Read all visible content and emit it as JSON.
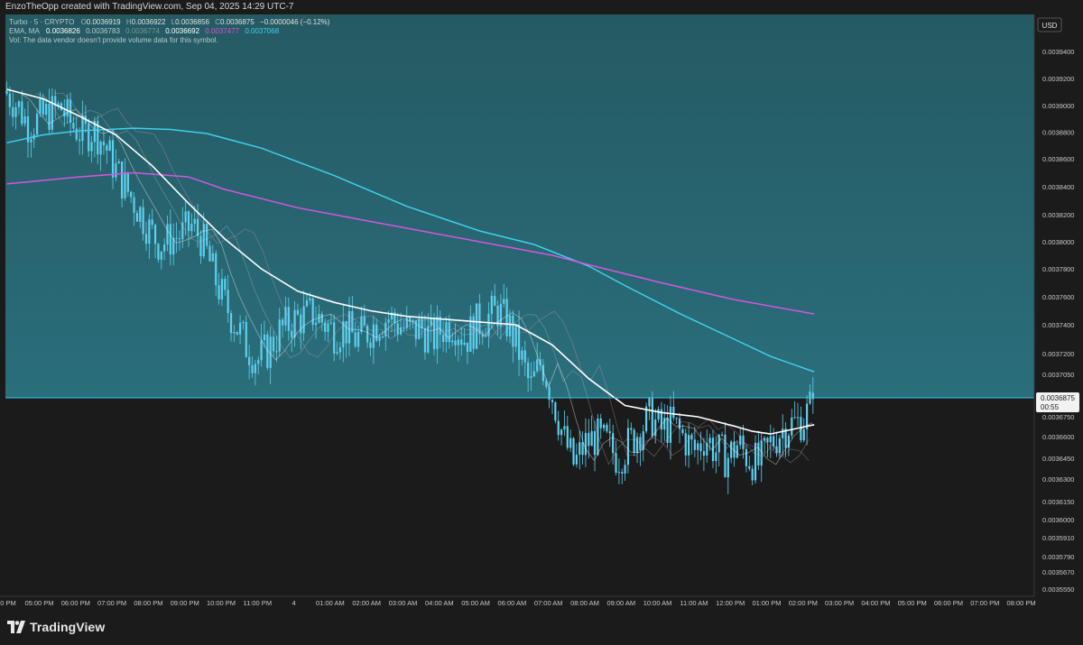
{
  "header": {
    "title": "EnzoTheOpp created with TradingView.com, Sep 04, 2025 14:29 UTC-7"
  },
  "legend": {
    "symbol": "Turbo · 5 · CRYPTO",
    "o_label": "O",
    "o": "0.0036919",
    "h_label": "H",
    "h": "0.0036922",
    "l_label": "L",
    "l": "0.0036856",
    "c_label": "C",
    "c": "0.0036875",
    "change": "−0.0000046 (−0.12%)",
    "ema_label": "EMA, MA",
    "ema_values": [
      "0.0036826",
      "0.0036783",
      "0.0036774",
      "0.0036692",
      "0.0037477",
      "0.0037068"
    ],
    "vol": "Vol: The data vendor doesn't provide volume data for this symbol."
  },
  "brand": {
    "name": "TradingView"
  },
  "colors": {
    "panel_top": "#255a63",
    "panel_bottom": "#2a6e7b",
    "candle": "#5fd0f0",
    "ema_white": "#ffffff",
    "ma_magenta": "#d257e0",
    "ma_cyan": "#3ed0ea",
    "price_line": "#34c6e2"
  },
  "chart_data": {
    "type": "candlestick",
    "currency": "USD",
    "last_price": "0.0036875",
    "countdown": "00:55",
    "y_ticks": [
      "0.0039400",
      "0.0039200",
      "0.0039000",
      "0.0038800",
      "0.0038600",
      "0.0038400",
      "0.0038200",
      "0.0038000",
      "0.0037800",
      "0.0037600",
      "0.0037400",
      "0.0037200",
      "0.0037050",
      "0.0036750",
      "0.0036600",
      "0.0036450",
      "0.0036300",
      "0.0036150",
      "0.0036000",
      "0.0035910",
      "0.0035790",
      "0.0035670",
      "0.0035550"
    ],
    "x_ticks": [
      "0 PM",
      "05:00 PM",
      "06:00 PM",
      "07:00 PM",
      "08:00 PM",
      "09:00 PM",
      "10:00 PM",
      "11:00 PM",
      "4",
      "01:00 AM",
      "02:00 AM",
      "03:00 AM",
      "04:00 AM",
      "05:00 AM",
      "06:00 AM",
      "07:00 AM",
      "08:00 AM",
      "09:00 AM",
      "10:00 AM",
      "11:00 AM",
      "12:00 PM",
      "01:00 PM",
      "02:00 PM",
      "03:00 PM",
      "04:00 PM",
      "05:00 PM",
      "06:00 PM",
      "07:00 PM",
      "08:00 PM"
    ],
    "close_path": [
      [
        0.0,
        0.003909
      ],
      [
        0.3,
        0.0039
      ],
      [
        0.6,
        0.003885
      ],
      [
        0.9,
        0.00389
      ],
      [
        1.2,
        0.003895
      ],
      [
        1.5,
        0.003898
      ],
      [
        1.8,
        0.003885
      ],
      [
        2.1,
        0.003878
      ],
      [
        2.4,
        0.003882
      ],
      [
        2.7,
        0.00387
      ],
      [
        3.0,
        0.003852
      ],
      [
        3.3,
        0.003838
      ],
      [
        3.6,
        0.003825
      ],
      [
        3.9,
        0.00381
      ],
      [
        4.2,
        0.003798
      ],
      [
        4.5,
        0.003802
      ],
      [
        4.8,
        0.003805
      ],
      [
        5.1,
        0.003812
      ],
      [
        5.4,
        0.0038
      ],
      [
        5.7,
        0.003775
      ],
      [
        6.0,
        0.003755
      ],
      [
        6.3,
        0.00374
      ],
      [
        6.6,
        0.003725
      ],
      [
        6.9,
        0.003715
      ],
      [
        7.2,
        0.003723
      ],
      [
        7.5,
        0.003735
      ],
      [
        7.8,
        0.003742
      ],
      [
        8.1,
        0.003745
      ],
      [
        8.4,
        0.003748
      ],
      [
        8.7,
        0.003742
      ],
      [
        9.0,
        0.003735
      ],
      [
        9.3,
        0.003738
      ],
      [
        9.6,
        0.00373
      ],
      [
        9.9,
        0.003735
      ],
      [
        10.2,
        0.003742
      ],
      [
        10.5,
        0.003745
      ],
      [
        10.8,
        0.00374
      ],
      [
        11.1,
        0.003735
      ],
      [
        11.4,
        0.003738
      ],
      [
        11.7,
        0.00373
      ],
      [
        12.0,
        0.003738
      ],
      [
        12.3,
        0.003742
      ],
      [
        12.6,
        0.00373
      ],
      [
        12.9,
        0.00374
      ],
      [
        13.2,
        0.003745
      ],
      [
        13.5,
        0.00375
      ],
      [
        13.8,
        0.00374
      ],
      [
        14.1,
        0.00372
      ],
      [
        14.4,
        0.003695
      ],
      [
        14.7,
        0.003715
      ],
      [
        15.0,
        0.00369
      ],
      [
        15.3,
        0.00366
      ],
      [
        15.6,
        0.00364
      ],
      [
        15.9,
        0.003655
      ],
      [
        16.2,
        0.00366
      ],
      [
        16.5,
        0.003655
      ],
      [
        16.8,
        0.003645
      ],
      [
        17.1,
        0.003655
      ],
      [
        17.4,
        0.003665
      ],
      [
        17.7,
        0.003675
      ],
      [
        18.0,
        0.003665
      ],
      [
        18.3,
        0.00367
      ],
      [
        18.6,
        0.00366
      ],
      [
        18.9,
        0.00365
      ],
      [
        19.2,
        0.00366
      ],
      [
        19.5,
        0.00365
      ],
      [
        19.8,
        0.003645
      ],
      [
        20.1,
        0.003655
      ],
      [
        20.4,
        0.003645
      ],
      [
        20.7,
        0.00364
      ],
      [
        21.0,
        0.003655
      ],
      [
        21.3,
        0.003665
      ],
      [
        21.6,
        0.00367
      ],
      [
        21.9,
        0.003672
      ],
      [
        22.2,
        0.0036875
      ]
    ],
    "ema_white": [
      [
        0.0,
        0.003912
      ],
      [
        1.0,
        0.003905
      ],
      [
        2.0,
        0.003892
      ],
      [
        3.0,
        0.003878
      ],
      [
        4.0,
        0.003855
      ],
      [
        5.0,
        0.003828
      ],
      [
        6.0,
        0.003802
      ],
      [
        7.0,
        0.00378
      ],
      [
        8.0,
        0.003764
      ],
      [
        9.0,
        0.003756
      ],
      [
        10.0,
        0.00375
      ],
      [
        11.0,
        0.003746
      ],
      [
        12.0,
        0.003744
      ],
      [
        13.0,
        0.003742
      ],
      [
        14.0,
        0.00374
      ],
      [
        15.0,
        0.003726
      ],
      [
        16.0,
        0.003702
      ],
      [
        17.0,
        0.003683
      ],
      [
        18.0,
        0.003678
      ],
      [
        19.0,
        0.003675
      ],
      [
        20.0,
        0.003668
      ],
      [
        20.5,
        0.003664
      ],
      [
        21.0,
        0.003662
      ],
      [
        22.2,
        0.003669
      ]
    ],
    "ma_magenta": [
      [
        0.0,
        0.003842
      ],
      [
        2.0,
        0.003847
      ],
      [
        3.5,
        0.00385
      ],
      [
        5.0,
        0.003847
      ],
      [
        6.0,
        0.003838
      ],
      [
        8.0,
        0.003825
      ],
      [
        10.0,
        0.003815
      ],
      [
        12.0,
        0.003805
      ],
      [
        14.0,
        0.003795
      ],
      [
        15.0,
        0.00379
      ],
      [
        16.0,
        0.003783
      ],
      [
        18.0,
        0.00377
      ],
      [
        20.0,
        0.003758
      ],
      [
        22.2,
        0.0037477
      ]
    ],
    "ma_cyan": [
      [
        0.0,
        0.003872
      ],
      [
        1.0,
        0.003878
      ],
      [
        2.0,
        0.003881
      ],
      [
        3.5,
        0.003883
      ],
      [
        4.5,
        0.003882
      ],
      [
        5.5,
        0.003879
      ],
      [
        7.0,
        0.003868
      ],
      [
        9.0,
        0.003848
      ],
      [
        11.0,
        0.003826
      ],
      [
        13.0,
        0.003808
      ],
      [
        14.5,
        0.003798
      ],
      [
        16.0,
        0.003782
      ],
      [
        17.0,
        0.003768
      ],
      [
        18.5,
        0.003748
      ],
      [
        20.0,
        0.00373
      ],
      [
        21.0,
        0.003718
      ],
      [
        22.2,
        0.0037068
      ]
    ]
  }
}
